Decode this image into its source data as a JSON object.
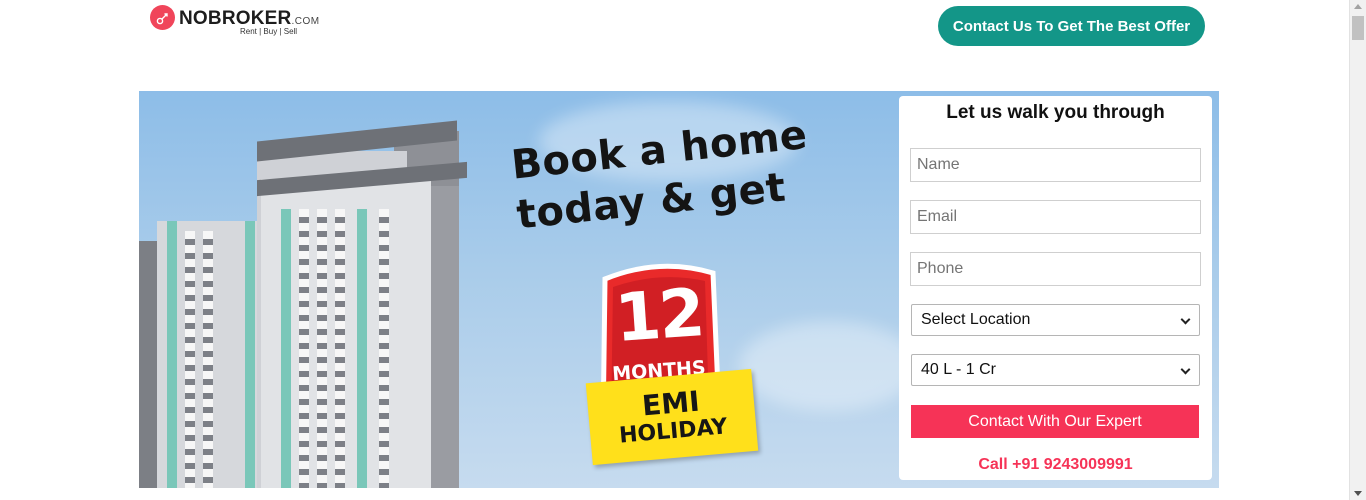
{
  "header": {
    "logo_brand": "NOBROKER",
    "logo_suffix": ".COM",
    "logo_tagline": "Rent | Buy | Sell",
    "cta_label": "Contact Us To Get The Best Offer"
  },
  "banner": {
    "headline_line1": "Book a home",
    "headline_line2": "today & get",
    "badge_number": "12",
    "badge_unit": "MONTHS",
    "ribbon_line1": "EMI",
    "ribbon_line2": "HOLIDAY"
  },
  "form": {
    "title": "Let us walk you through",
    "name_placeholder": "Name",
    "email_placeholder": "Email",
    "phone_placeholder": "Phone",
    "location_selected": "Select Location",
    "budget_selected": "40 L - 1 Cr",
    "submit_label": "Contact With Our Expert",
    "call_text": "Call +91 9243009991"
  },
  "colors": {
    "brand_red": "#f63357",
    "cta_teal": "#139688",
    "sky_blue": "#8dbde8",
    "ribbon_yellow": "#ffe01b"
  },
  "icons": {
    "logo": "nobroker-logo-icon",
    "select_arrow": "chevron-down-icon"
  }
}
